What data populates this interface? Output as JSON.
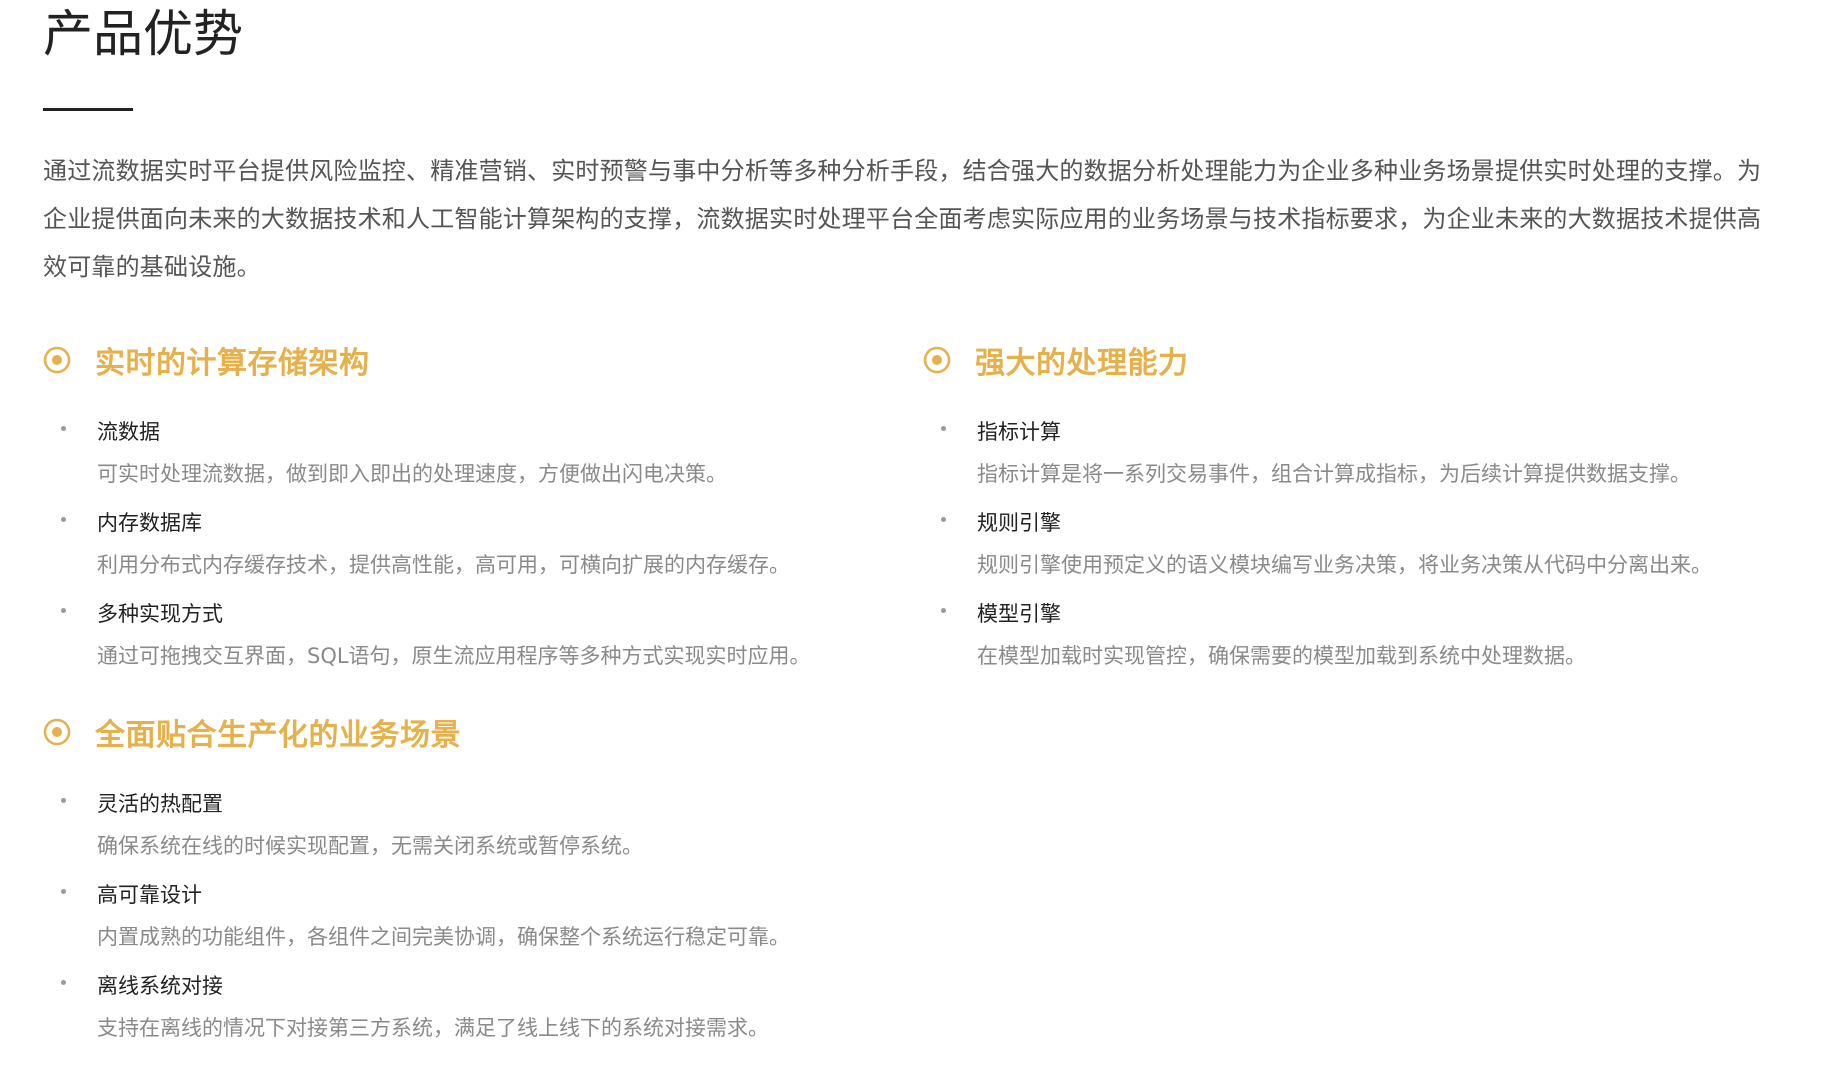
{
  "page": {
    "title": "产品优势",
    "intro": "通过流数据实时平台提供风险监控、精准营销、实时预警与事中分析等多种分析手段，结合强大的数据分析处理能力为企业多种业务场景提供实时处理的支撑。为企业提供面向未来的大数据技术和人工智能计算架构的支撑，流数据实时处理平台全面考虑实际应用的业务场景与技术指标要求，为企业未来的大数据技术提供高效可靠的基础设施。"
  },
  "colors": {
    "accent": "#e6b04a",
    "heading": "#222222",
    "body": "#555555",
    "muted": "#8a8a8a"
  },
  "features": [
    {
      "icon": "target-icon",
      "title": "实时的计算存储架构",
      "items": [
        {
          "title": "流数据",
          "desc": "可实时处理流数据，做到即入即出的处理速度，方便做出闪电决策。"
        },
        {
          "title": "内存数据库",
          "desc": "利用分布式内存缓存技术，提供高性能，高可用，可横向扩展的内存缓存。"
        },
        {
          "title": "多种实现方式",
          "desc": "通过可拖拽交互界面，SQL语句，原生流应用程序等多种方式实现实时应用。"
        }
      ]
    },
    {
      "icon": "target-icon",
      "title": "强大的处理能力",
      "items": [
        {
          "title": "指标计算",
          "desc": "指标计算是将一系列交易事件，组合计算成指标，为后续计算提供数据支撑。"
        },
        {
          "title": "规则引擎",
          "desc": "规则引擎使用预定义的语义模块编写业务决策，将业务决策从代码中分离出来。"
        },
        {
          "title": "模型引擎",
          "desc": "在模型加载时实现管控，确保需要的模型加载到系统中处理数据。"
        }
      ]
    },
    {
      "icon": "target-icon",
      "title": "全面贴合生产化的业务场景",
      "items": [
        {
          "title": "灵活的热配置",
          "desc": "确保系统在线的时候实现配置，无需关闭系统或暂停系统。"
        },
        {
          "title": "高可靠设计",
          "desc": "内置成熟的功能组件，各组件之间完美协调，确保整个系统运行稳定可靠。"
        },
        {
          "title": "离线系统对接",
          "desc": "支持在离线的情况下对接第三方系统，满足了线上线下的系统对接需求。"
        }
      ]
    }
  ]
}
